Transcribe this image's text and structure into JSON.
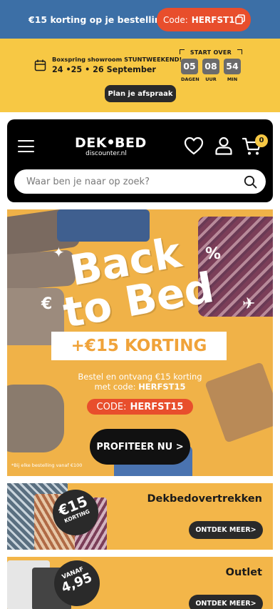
{
  "promo": {
    "text": "€15 korting op je bestelling!",
    "code_label": "Code:",
    "code_value": "HERFST15",
    "colors": {
      "bar": "#3c6fa6",
      "pill": "#e84e2c"
    }
  },
  "showroom": {
    "line1": "Boxspring showroom STUNTWEEKEND!",
    "line2": "24 •25 • 26 September",
    "start_label": "START OVER",
    "countdown": [
      {
        "value": "05",
        "unit": "DAGEN"
      },
      {
        "value": "08",
        "unit": "UUR"
      },
      {
        "value": "54",
        "unit": "MIN"
      }
    ],
    "button": "Plan je afspraak",
    "color": "#f7c844"
  },
  "header": {
    "logo_main_left": "DEK",
    "logo_main_right": "BED",
    "logo_sub": "discounter.nl",
    "cart_count": "0",
    "search_placeholder": "Waar ben je naar op zoek?",
    "icons": [
      "menu-icon",
      "heart-icon",
      "user-icon",
      "cart-icon",
      "search-icon"
    ]
  },
  "hero": {
    "title_line1": "Back",
    "title_line2": "to Bed",
    "korting": "+€15 KORTING",
    "sub1": "Bestel en ontvang €15 korting",
    "sub2_prefix": "met code:",
    "sub2_code": "HERFST15",
    "code_label": "CODE:",
    "code_value": "HERFST15",
    "cta": "PROFITEER NU >",
    "fine_print": "*Bij elke bestelling vanaf €100"
  },
  "categories": [
    {
      "title": "Dekbedovertrekken",
      "badge_big": "€15",
      "badge_small": "KORTING",
      "button": "ONTDEK MEER>"
    },
    {
      "title": "Outlet",
      "badge_small": "VANAF",
      "badge_big": "4,95",
      "button": "ONTDEK MEER>"
    }
  ]
}
